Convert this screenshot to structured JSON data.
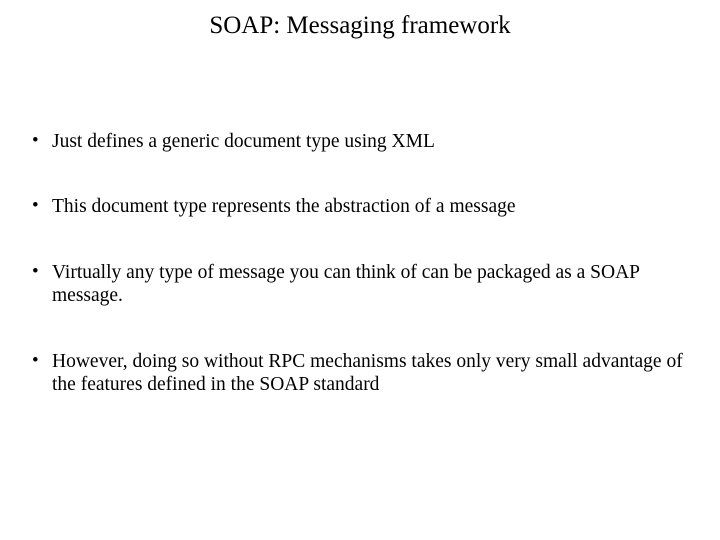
{
  "title": "SOAP: Messaging framework",
  "bullets": [
    "Just defines a generic document type using XML",
    "This document type represents the abstraction of a message",
    "Virtually any type of message you can think of can be packaged as a SOAP message.",
    "However, doing so without RPC mechanisms takes only very small advantage of the features defined in the SOAP standard"
  ]
}
